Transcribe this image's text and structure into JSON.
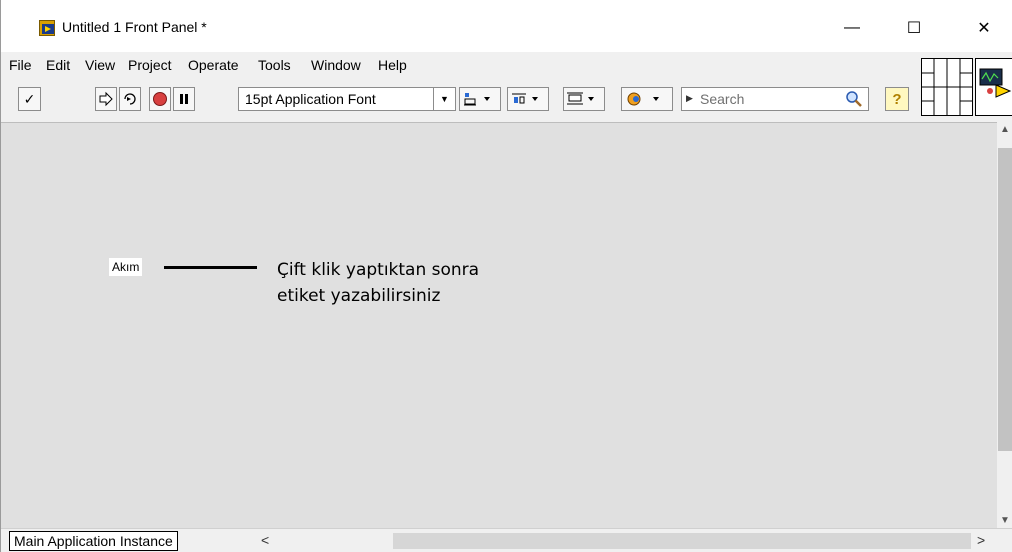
{
  "window": {
    "title": "Untitled 1 Front Panel *",
    "minimize": "—",
    "maximize": "☐",
    "close": "✕"
  },
  "menubar": {
    "items": [
      "File",
      "Edit",
      "View",
      "Project",
      "Operate",
      "Tools",
      "Window",
      "Help"
    ]
  },
  "toolbar": {
    "check": "✓",
    "font_label": "15pt Application Font",
    "search_placeholder": "Search",
    "help_label": "?"
  },
  "panel": {
    "control_label": "Akım",
    "annotation_line1": "Çift klik yaptıktan sonra",
    "annotation_line2": "etiket yazabilirsiniz"
  },
  "statusbar": {
    "instance": "Main Application Instance"
  },
  "colors": {
    "panel_bg": "#e0e0e0",
    "toolbar_bg": "#f0f0f0",
    "run_button": "#d84040",
    "help_yellow": "#f5d400"
  }
}
